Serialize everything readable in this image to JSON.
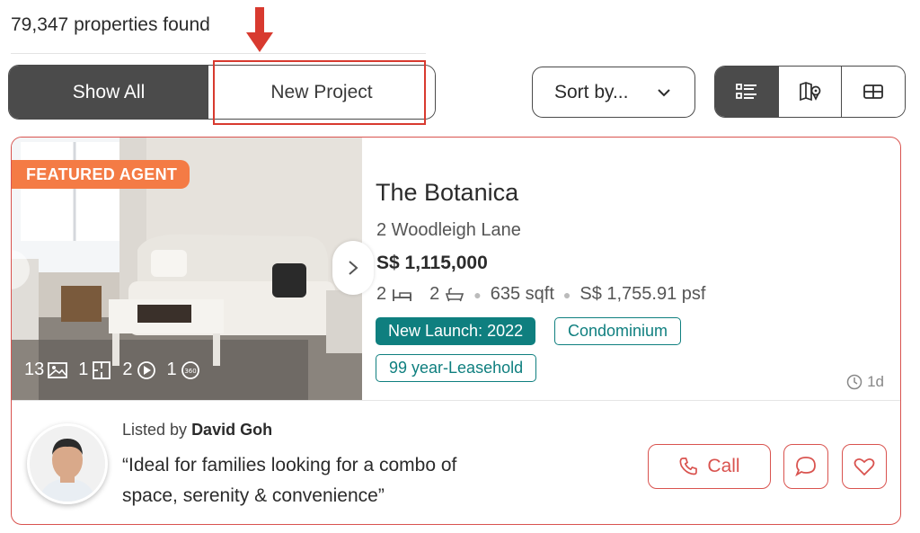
{
  "results": {
    "count_text": "79,347 properties found"
  },
  "filter": {
    "show_all": "Show All",
    "new_project": "New Project"
  },
  "sort": {
    "label": "Sort by..."
  },
  "views": {
    "icons": [
      "list-view-icon",
      "map-view-icon",
      "grid-view-icon"
    ]
  },
  "listing": {
    "featured_badge": "FEATURED AGENT",
    "media": {
      "photos": "13",
      "floorplans": "1",
      "videos": "2",
      "virtual_tours": "1"
    },
    "title": "The Botanica",
    "address": "2 Woodleigh Lane",
    "price": "S$ 1,115,000",
    "beds": "2",
    "baths": "2",
    "area": "635 sqft",
    "psf": "S$ 1,755.91 psf",
    "tags": {
      "launch": "New Launch: 2022",
      "type": "Condominium",
      "tenure": "99 year-Leasehold"
    },
    "age": "1d"
  },
  "agent": {
    "listed_by_prefix": "Listed by",
    "name": "David Goh",
    "quote": "“Ideal for families looking for a combo of space, serenity & convenience”"
  },
  "actions": {
    "call": "Call"
  },
  "colors": {
    "accent": "#d9534f",
    "teal": "#0f7f7f",
    "featured": "#f47b45",
    "dark": "#4b4b4b",
    "annotation": "#d83a2f"
  }
}
